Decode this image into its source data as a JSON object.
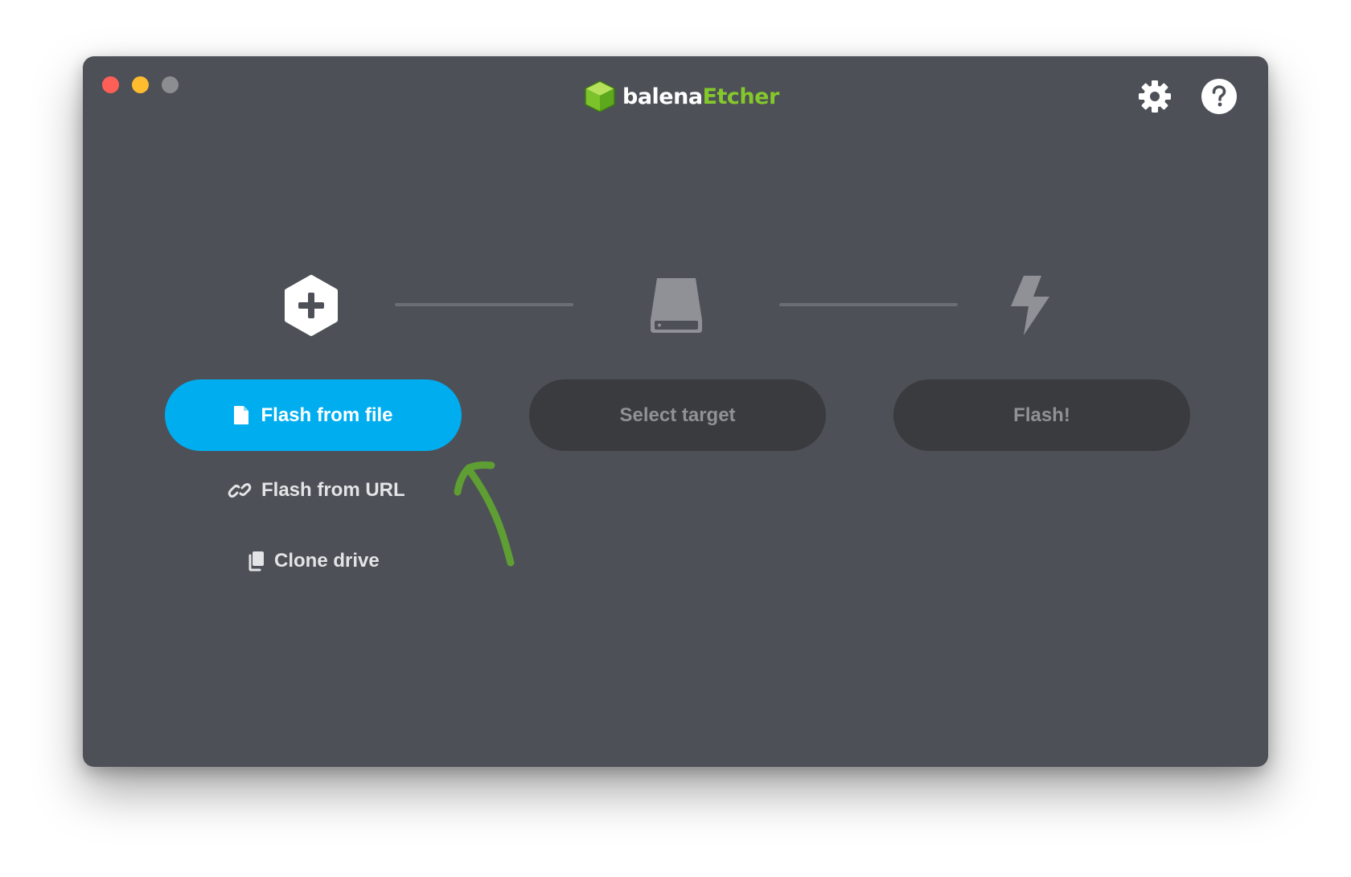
{
  "app": {
    "brand_prefix": "balena",
    "brand_suffix": "Etcher"
  },
  "colors": {
    "window_bg": "#4d5057",
    "accent_blue": "#00aeef",
    "brand_green": "#85c82b",
    "disabled_button_bg": "#3a3b3f",
    "annotation_green": "#5e9e32"
  },
  "header": {
    "settings_icon": "gear-icon",
    "help_icon": "question-mark-icon"
  },
  "steps": {
    "source_icon": "plus-hexagon-icon",
    "target_icon": "drive-icon",
    "flash_icon": "lightning-bolt-icon"
  },
  "buttons": {
    "flash_from_file": "Flash from file",
    "select_target": "Select target",
    "flash": "Flash!"
  },
  "source_options": {
    "flash_from_url": "Flash from URL",
    "clone_drive": "Clone drive"
  }
}
